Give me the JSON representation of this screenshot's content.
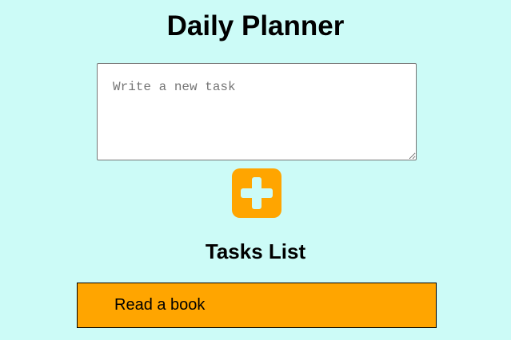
{
  "header": {
    "title": "Daily Planner"
  },
  "task_input": {
    "value": "",
    "placeholder": "Write a new task"
  },
  "add_button": {
    "icon": "plus-icon",
    "accent_color": "#ffa500"
  },
  "tasks": {
    "heading": "Tasks List",
    "items": [
      {
        "label": "Read a book"
      }
    ]
  },
  "colors": {
    "background": "#ccfbf7",
    "accent": "#ffa500"
  }
}
